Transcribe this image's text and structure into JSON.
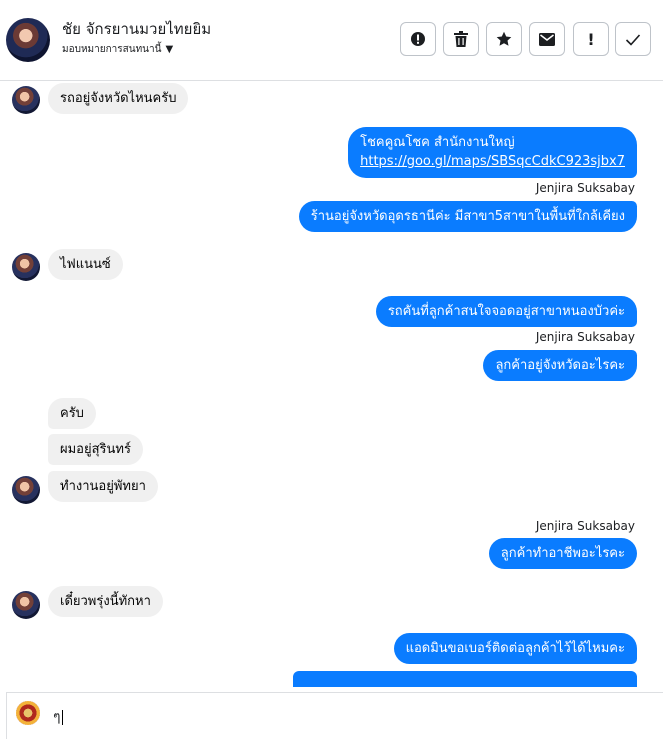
{
  "header": {
    "contact_name": "ชัย จักรยานมวยไทยยิม",
    "assign_label": "มอบหมายการสนทนานี้",
    "actions": [
      {
        "icon": "alert-circle-icon",
        "name": "report-button"
      },
      {
        "icon": "trash-icon",
        "name": "delete-button"
      },
      {
        "icon": "star-icon",
        "name": "star-button"
      },
      {
        "icon": "mail-icon",
        "name": "mark-unread-button"
      },
      {
        "icon": "exclamation-icon",
        "name": "spam-button"
      },
      {
        "icon": "check-icon",
        "name": "done-button"
      }
    ]
  },
  "messages": [
    {
      "dir": "in",
      "text": "รถอยู่จังหวัดไหนครับ",
      "avatar": true
    },
    {
      "dir": "out",
      "lines": [
        "โชคคูณโชค สำนักงานใหญ่",
        "https://goo.gl/maps/SBSqcCdkC923sjbx7"
      ]
    },
    {
      "dir": "sender",
      "text": "Jenjira Suksabay"
    },
    {
      "dir": "out",
      "text": "ร้านอยู่จังหวัดอุดรธานีค่ะ มีสาขา5สาขาในพื้นที่ใกล้เคียง"
    },
    {
      "dir": "in",
      "text": "ไฟแนนซ์",
      "avatar": true
    },
    {
      "dir": "out",
      "text": "รถคันที่ลูกค้าสนใจจอดอยู่สาขาหนองบัวค่ะ"
    },
    {
      "dir": "sender",
      "text": "Jenjira Suksabay"
    },
    {
      "dir": "out",
      "text": "ลูกค้าอยู่จังหวัดอะไรคะ"
    },
    {
      "dir": "in",
      "text": "ครับ"
    },
    {
      "dir": "in",
      "text": "ผมอยู่สุรินทร์"
    },
    {
      "dir": "in",
      "text": "ทำงานอยู่พัทยา",
      "avatar": true
    },
    {
      "dir": "sender",
      "text": "Jenjira Suksabay"
    },
    {
      "dir": "out",
      "text": "ลูกค้าทำอาชีพอะไรคะ"
    },
    {
      "dir": "in",
      "text": "เดี๋ยวพรุ่งนี้ทักหา",
      "avatar": true
    },
    {
      "dir": "out",
      "text": "แอดมินขอเบอร์ติดต่อลูกค้าไว้ได้ไหมคะ"
    }
  ],
  "composer": {
    "value": "ๆ"
  },
  "colors": {
    "outgoing": "#0a7cff",
    "incoming": "#f0f0f0"
  }
}
